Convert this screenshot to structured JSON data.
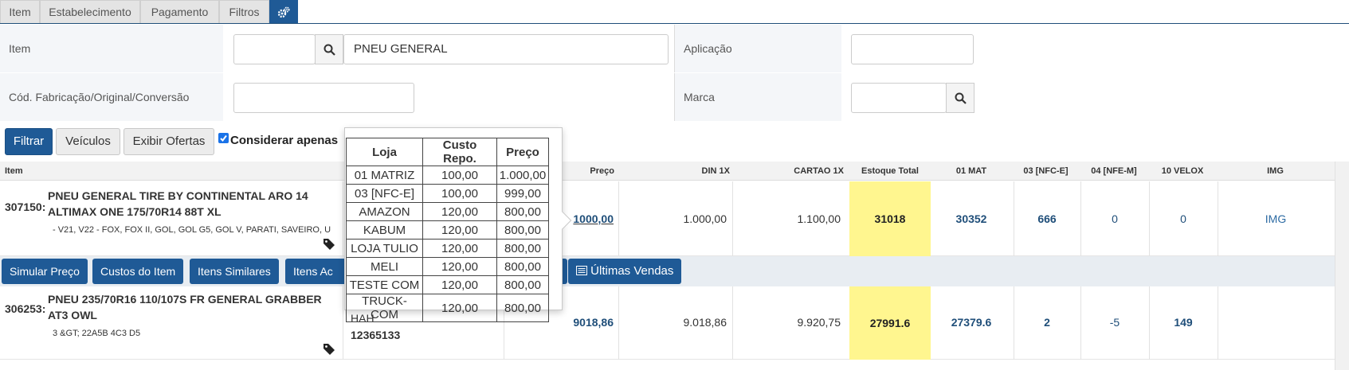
{
  "tabs": [
    "Item",
    "Estabelecimento",
    "Pagamento",
    "Filtros"
  ],
  "form": {
    "item_label": "Item",
    "item_code_value": "",
    "item_desc_value": "PNEU GENERAL",
    "aplicacao_label": "Aplicação",
    "aplicacao_value": "",
    "cod_label": "Cód. Fabricação/Original/Conversão",
    "cod_value": "",
    "marca_label": "Marca",
    "marca_value": ""
  },
  "toolbar": {
    "filtrar": "Filtrar",
    "veiculos": "Veículos",
    "exibir_ofertas": "Exibir Ofertas",
    "considerar": "Considerar apenas"
  },
  "grid": {
    "headers": {
      "item": "Item",
      "preco": "Preço",
      "din": "DIN 1X",
      "cartao": "CARTAO 1X",
      "estoque": "Estoque Total",
      "mat": "01 MAT",
      "nfce": "03 [NFC-E]",
      "nfem": "04 [NFE-M]",
      "velox": "10 VELOX",
      "img": "IMG"
    },
    "rows": [
      {
        "code": "307150:",
        "name_line1": "PNEU GENERAL TIRE BY CONTINENTAL ARO 14",
        "name_line2": "ALTIMAX ONE 175/70R14 88T XL",
        "app": "- V21, V22 - FOX, FOX II, GOL, GOL G5, GOL V, PARATI, SAVEIRO, U",
        "brand": "",
        "ref": "",
        "preco": "1000,00",
        "din": "1.000,00",
        "cartao": "1.100,00",
        "estoque": "31018",
        "mat": "30352",
        "nfce": "666",
        "nfem": "0",
        "velox": "0",
        "img": "IMG"
      },
      {
        "code": "306253:",
        "name_line1": "PNEU 235/70R16 110/107S FR GENERAL GRABBER",
        "name_line2": "AT3 OWL",
        "app": "3 &GT; 22A5B 4C3 D5",
        "brand": "HAH",
        "ref": "12365133",
        "preco": "9018,86",
        "din": "9.018,86",
        "cartao": "9.920,75",
        "estoque": "27991.6",
        "mat": "27379.6",
        "nfce": "2",
        "nfem": "-5",
        "velox": "149",
        "img": ""
      }
    ]
  },
  "actions": {
    "simular": "Simular Preço",
    "custos": "Custos do Item",
    "similares": "Itens Similares",
    "adicionais": "Itens Ac",
    "ultimas": "Últimas Vendas"
  },
  "popover": {
    "headers": [
      "Loja",
      "Custo Repo.",
      "Preço"
    ],
    "rows": [
      [
        "01 MATRIZ",
        "100,00",
        "1.000,00"
      ],
      [
        "03 [NFC-E]",
        "100,00",
        "999,00"
      ],
      [
        "AMAZON",
        "120,00",
        "800,00"
      ],
      [
        "KABUM",
        "120,00",
        "800,00"
      ],
      [
        "LOJA TULIO",
        "120,00",
        "800,00"
      ],
      [
        "MELI",
        "120,00",
        "800,00"
      ],
      [
        "TESTE COM",
        "120,00",
        "800,00"
      ],
      [
        "TRUCK-COM",
        "120,00",
        "800,00"
      ]
    ]
  },
  "colors": {
    "accent": "#1f5a96",
    "stock_bg": "#fff68f",
    "link": "#1f4e79"
  },
  "icons": [
    "gears-icon",
    "search-icon",
    "tag-icon",
    "list-icon",
    "checkbox-icon"
  ]
}
